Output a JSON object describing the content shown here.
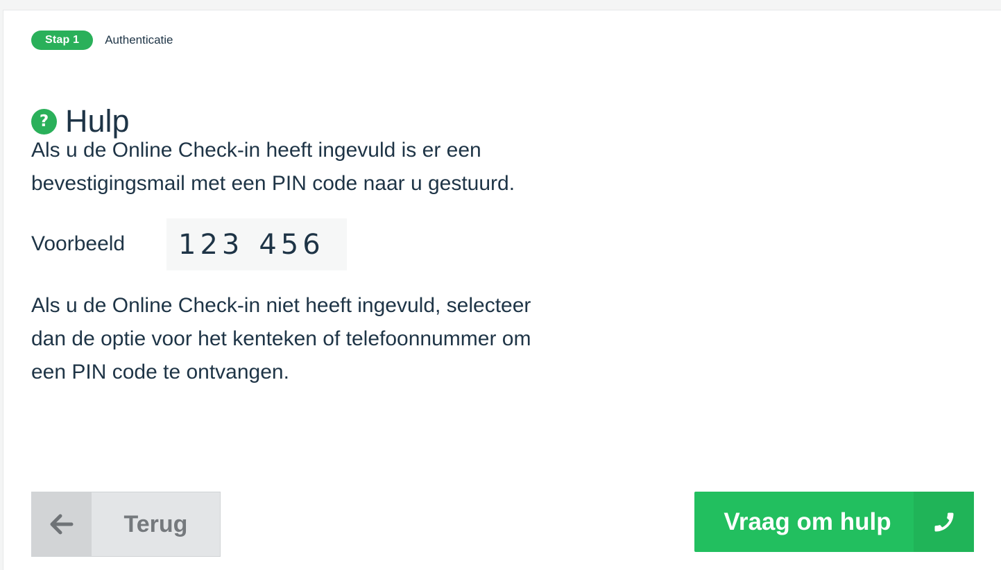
{
  "step": {
    "badge": "Stap 1",
    "label": "Authenticatie"
  },
  "header": {
    "icon": "help-icon",
    "icon_glyph": "?",
    "title": "Hulp"
  },
  "content": {
    "paragraph1": "Als u de Online Check-in heeft ingevuld is er een bevestigingsmail met een PIN code naar u gestuurd.",
    "example_label": "Voorbeeld",
    "example_pin_part1": "123",
    "example_pin_part2": "456",
    "paragraph2": "Als u de Online Check-in niet heeft ingevuld, selecteer dan de optie voor het kenteken of telefoonnummer om een PIN code te ontvangen."
  },
  "actions": {
    "back_label": "Terug",
    "back_icon": "arrow-left-icon",
    "help_label": "Vraag om hulp",
    "help_icon": "phone-icon"
  },
  "colors": {
    "accent": "#2ab05a",
    "button_green": "#22bf5f",
    "text": "#1e3446",
    "back_button_bg": "#e3e5e7"
  }
}
